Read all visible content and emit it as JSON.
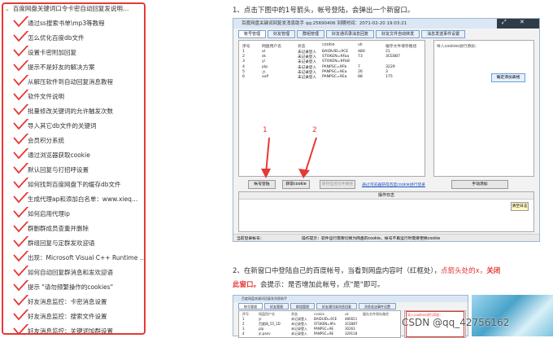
{
  "sidebar": {
    "top": "百度网盘关键词口令卡密自动回复发说明…",
    "items": [
      {
        "label": "通过ss搜索书单\\mp3等教程"
      },
      {
        "label": "怎么优化百度db文件"
      },
      {
        "label": "设置卡密附加回复"
      },
      {
        "label": "提示不是好友的解决方案"
      },
      {
        "label": "从解压软件到自动回复消息教程"
      },
      {
        "label": "软件文件说明"
      },
      {
        "label": "批量修改关键词的允许触发次数"
      },
      {
        "label": "导入其它db文件的关键词"
      },
      {
        "label": "会员积分系统"
      },
      {
        "label": "通过浏览器获取cookie"
      },
      {
        "label": "默认回复与打招呼设置"
      },
      {
        "label": "如何找到百度网盘下的缓存db文件"
      },
      {
        "label": "生成代理ap和添加白名单：www.xieq…"
      },
      {
        "label": "如何启用代理ip"
      },
      {
        "label": "群删群成员查重并删除"
      },
      {
        "label": "群组回复与定群发欢迎语"
      },
      {
        "label": "出现：Microsoft Visual C++ Runtime …"
      },
      {
        "label": "如何自动回复群消息和发欢迎语"
      },
      {
        "label": "提示 \"请勿频繁操作的cookies\""
      },
      {
        "label": "好友消息监控：卡密消息设置"
      },
      {
        "label": "好友消息监控：搜索文件设置"
      },
      {
        "label": "好友消息监控：关键词加群设置"
      }
    ]
  },
  "step1": {
    "text": "1、点击下图中的1号箭头，帐号登陆，会弹出一个新窗口。"
  },
  "step2": {
    "a": "2、在新窗口中登陆自己的百度帐号，当看到网盘内容时（红框处），",
    "b": "点箭头处的x，",
    "c": "关闭",
    "d": "此窗口。",
    "e": "会提示：是否增加此帐号，点\"是\"即可。"
  },
  "app1": {
    "title": "百度网盘关键词回复发消息助手  qq:25690406  到期时间：2071-02-20 19:03:21",
    "tabs": [
      "帐号管理",
      "好友管理",
      "群组管理",
      "好友通讯录消息回复",
      "好友文件自动转发",
      "消息发送事件设置"
    ],
    "headers": [
      "序号",
      "网盘用户名",
      "状态",
      "cookie",
      "uk",
      "缓存文件保存路径"
    ],
    "rows": [
      [
        "1",
        "ol",
        "未记录登入",
        "BAIDUID=9CE",
        "480",
        "21"
      ],
      [
        "2",
        "sk",
        "未记录登入",
        "STOKEN=9Faa",
        "73",
        "3CE8B7"
      ],
      [
        "3",
        "yi",
        "未记录登入",
        "STOKEN=9Fb8",
        "",
        ""
      ],
      [
        "4",
        "plp",
        "未记录登入",
        "PANPSC=9Fb",
        "7",
        "3229"
      ],
      [
        "5",
        "小",
        "未记录登入",
        "PANPSC=9Ea",
        "26",
        "3"
      ],
      [
        "6",
        "xxP",
        "未记录登入",
        "PANPSC=9Ea",
        "88",
        "175"
      ]
    ],
    "side_label": "导入cookies进行添加：",
    "side_btn": "确定添加表格",
    "arrow1": "1",
    "arrow2": "2",
    "btn_login": "帐号登陆",
    "btn_cookie": "获取cookie",
    "btn_save": "保存监控文件路径",
    "link": "通过浏览器获得百度cookie进行登录",
    "btn_manual": "手动添加",
    "log_header": "操作日志",
    "log_btn": "清空日志",
    "status_left": "当前登录帐号：",
    "status_right": "操作提示：软件运行需要切换为网盘的cookie，帐号不再运行时需要更换cookie"
  },
  "app2": {
    "title": "百度网盘关键词回复发消息助手",
    "tabs": [
      "帐号管理",
      "好友管理",
      "群组管理",
      "好友通讯录消息回复",
      "消息发送事件设置"
    ],
    "headers": [
      "序号",
      "网盘用户名",
      "状态",
      "cookie",
      "uk",
      "缓存文件保存路径"
    ],
    "rows": [
      [
        "1",
        "yi",
        "未记录登入",
        "BAIDUID=9CE",
        "480021"
      ],
      [
        "2",
        "百度网_55_1D",
        "未记录登入",
        "STOKEN=9Fa",
        "3CE8B7"
      ],
      [
        "3",
        "plp",
        "未记录登入",
        "PANPSC=9E",
        "30263"
      ],
      [
        "4",
        "yl.panv",
        "未记录登入",
        "PANPSC=9E",
        "329118"
      ]
    ],
    "side_label": "导入cookies进行添加："
  },
  "watermark": "CSDN @qq_42756162"
}
